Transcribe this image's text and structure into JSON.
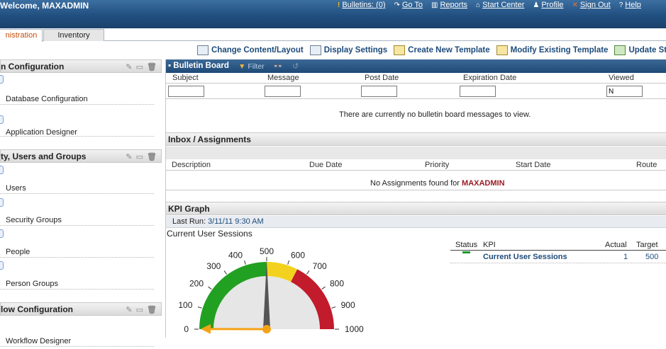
{
  "header": {
    "welcome": "Welcome, MAXADMIN",
    "nav": [
      {
        "label": "Bulletins: (0)",
        "icon": "bulletin-alert-icon"
      },
      {
        "label": "Go To",
        "icon": "goto-arrow-icon"
      },
      {
        "label": "Reports",
        "icon": "reports-chart-icon"
      },
      {
        "label": "Start Center",
        "icon": "home-icon"
      },
      {
        "label": "Profile",
        "icon": "profile-person-icon"
      },
      {
        "label": "Sign Out",
        "icon": "sign-out-x-icon"
      },
      {
        "label": "Help",
        "icon": "help-question-icon"
      }
    ]
  },
  "tabs": [
    {
      "label": "Administration",
      "active": true,
      "visible_text": "nistration"
    },
    {
      "label": "Inventory",
      "active": false
    }
  ],
  "toolbar": [
    {
      "label": "Change Content/Layout",
      "icon": "layout-icon"
    },
    {
      "label": "Display Settings",
      "icon": "display-settings-icon"
    },
    {
      "label": "Create New Template",
      "icon": "create-template-icon"
    },
    {
      "label": "Modify Existing Template",
      "icon": "modify-template-icon"
    },
    {
      "label": "Update St",
      "icon": "update-icon"
    }
  ],
  "left_panel": {
    "sections": [
      {
        "title": "n Configuration",
        "items": [
          "Database Configuration",
          "Application Designer"
        ]
      },
      {
        "title": "ty, Users and Groups",
        "items": [
          "Users",
          "Security Groups",
          "People",
          "Person Groups"
        ]
      },
      {
        "title": "low Configuration",
        "items": [
          "Workflow Designer"
        ]
      }
    ]
  },
  "bulletin_board": {
    "title": "Bulletin Board",
    "filter_label": "Filter",
    "columns": [
      "Subject",
      "Message",
      "Post Date",
      "Expiration Date",
      "Viewed"
    ],
    "viewed_filter_value": "N",
    "empty_message": "There are currently no bulletin board messages to view."
  },
  "inbox": {
    "title": "Inbox / Assignments",
    "columns": [
      "Description",
      "Due Date",
      "Priority",
      "Start Date",
      "Route"
    ],
    "empty_prefix": "No Assignments found for",
    "empty_user": "MAXADMIN"
  },
  "kpi_graph": {
    "title": "KPI Graph",
    "last_run_label": "Last Run:",
    "last_run_value": "3/11/11 9:30 AM",
    "chart_title": "Current User Sessions",
    "table": {
      "headers": [
        "Status",
        "KPI",
        "Actual",
        "Target"
      ],
      "rows": [
        {
          "kpi": "Current User Sessions",
          "actual": "1",
          "target": "500",
          "status_color": "#1b9b2a"
        }
      ]
    }
  },
  "chart_data": {
    "type": "gauge",
    "title": "Current User Sessions",
    "min": 0,
    "max": 1000,
    "ticks": [
      "0",
      "100",
      "200",
      "300",
      "400",
      "500",
      "600",
      "700",
      "800",
      "900",
      "1000"
    ],
    "bands": [
      {
        "from": 0,
        "to": 500,
        "color": "#22a022"
      },
      {
        "from": 500,
        "to": 650,
        "color": "#f2d21f"
      },
      {
        "from": 650,
        "to": 1000,
        "color": "#c21b2c"
      }
    ],
    "target": 500,
    "actual": 1,
    "actual_color": "#f5a316",
    "target_color": "#555555"
  }
}
